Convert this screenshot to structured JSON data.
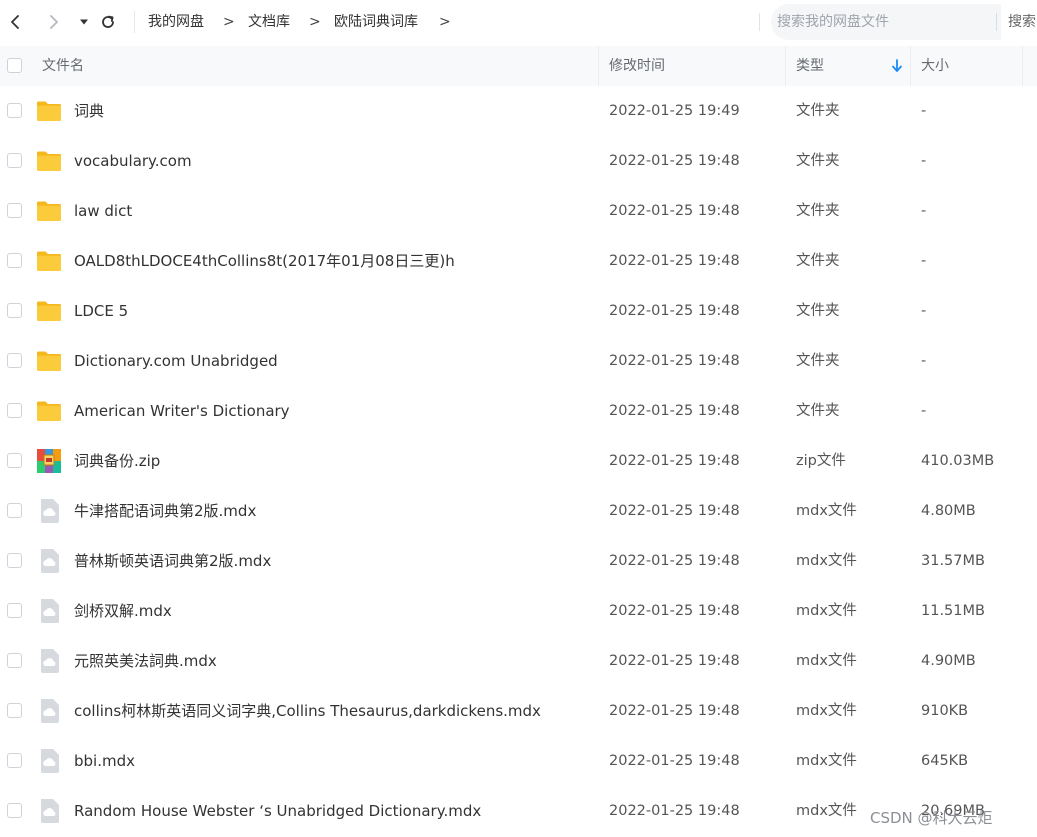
{
  "nav": {
    "breadcrumb": [
      "我的网盘",
      "文档库",
      "欧陆词典词库"
    ],
    "separator": ">"
  },
  "search": {
    "placeholder": "搜索我的网盘文件",
    "button_label": "搜索"
  },
  "table": {
    "columns": {
      "name": "文件名",
      "modified": "修改时间",
      "type": "类型",
      "size": "大小"
    },
    "rows": [
      {
        "name": "词典",
        "modified": "2022-01-25 19:49",
        "type": "文件夹",
        "size": "-",
        "icon": "folder-icon"
      },
      {
        "name": "vocabulary.com",
        "modified": "2022-01-25 19:48",
        "type": "文件夹",
        "size": "-",
        "icon": "folder-icon"
      },
      {
        "name": "law dict",
        "modified": "2022-01-25 19:48",
        "type": "文件夹",
        "size": "-",
        "icon": "folder-icon"
      },
      {
        "name": "OALD8thLDOCE4thCollins8t(2017年01月08日三更)h",
        "modified": "2022-01-25 19:48",
        "type": "文件夹",
        "size": "-",
        "icon": "folder-icon"
      },
      {
        "name": "LDCE 5",
        "modified": "2022-01-25 19:48",
        "type": "文件夹",
        "size": "-",
        "icon": "folder-icon"
      },
      {
        "name": "Dictionary.com Unabridged",
        "modified": "2022-01-25 19:48",
        "type": "文件夹",
        "size": "-",
        "icon": "folder-icon"
      },
      {
        "name": "American Writer's Dictionary",
        "modified": "2022-01-25 19:48",
        "type": "文件夹",
        "size": "-",
        "icon": "folder-icon"
      },
      {
        "name": "词典备份.zip",
        "modified": "2022-01-25 19:48",
        "type": "zip文件",
        "size": "410.03MB",
        "icon": "zip-archive-icon"
      },
      {
        "name": "牛津搭配语词典第2版.mdx",
        "modified": "2022-01-25 19:48",
        "type": "mdx文件",
        "size": "4.80MB",
        "icon": "file-icon"
      },
      {
        "name": "普林斯顿英语词典第2版.mdx",
        "modified": "2022-01-25 19:48",
        "type": "mdx文件",
        "size": "31.57MB",
        "icon": "file-icon"
      },
      {
        "name": "剑桥双解.mdx",
        "modified": "2022-01-25 19:48",
        "type": "mdx文件",
        "size": "11.51MB",
        "icon": "file-icon"
      },
      {
        "name": "元照英美法詞典.mdx",
        "modified": "2022-01-25 19:48",
        "type": "mdx文件",
        "size": "4.90MB",
        "icon": "file-icon"
      },
      {
        "name": "collins柯林斯英语同义词字典,Collins Thesaurus,darkdickens.mdx",
        "modified": "2022-01-25 19:48",
        "type": "mdx文件",
        "size": "910KB",
        "icon": "file-icon"
      },
      {
        "name": "bbi.mdx",
        "modified": "2022-01-25 19:48",
        "type": "mdx文件",
        "size": "645KB",
        "icon": "file-icon"
      },
      {
        "name": "Random House Webster ‘s Unabridged Dictionary.mdx",
        "modified": "2022-01-25 19:48",
        "type": "mdx文件",
        "size": "20.69MB",
        "icon": "file-icon"
      }
    ]
  },
  "watermark": "CSDN @科大云炬",
  "colors": {
    "folder": "#fccb3c",
    "folder_tab": "#f5b91f",
    "sort_arrow": "#1b8af5",
    "file_icon": "#d6d9de"
  }
}
